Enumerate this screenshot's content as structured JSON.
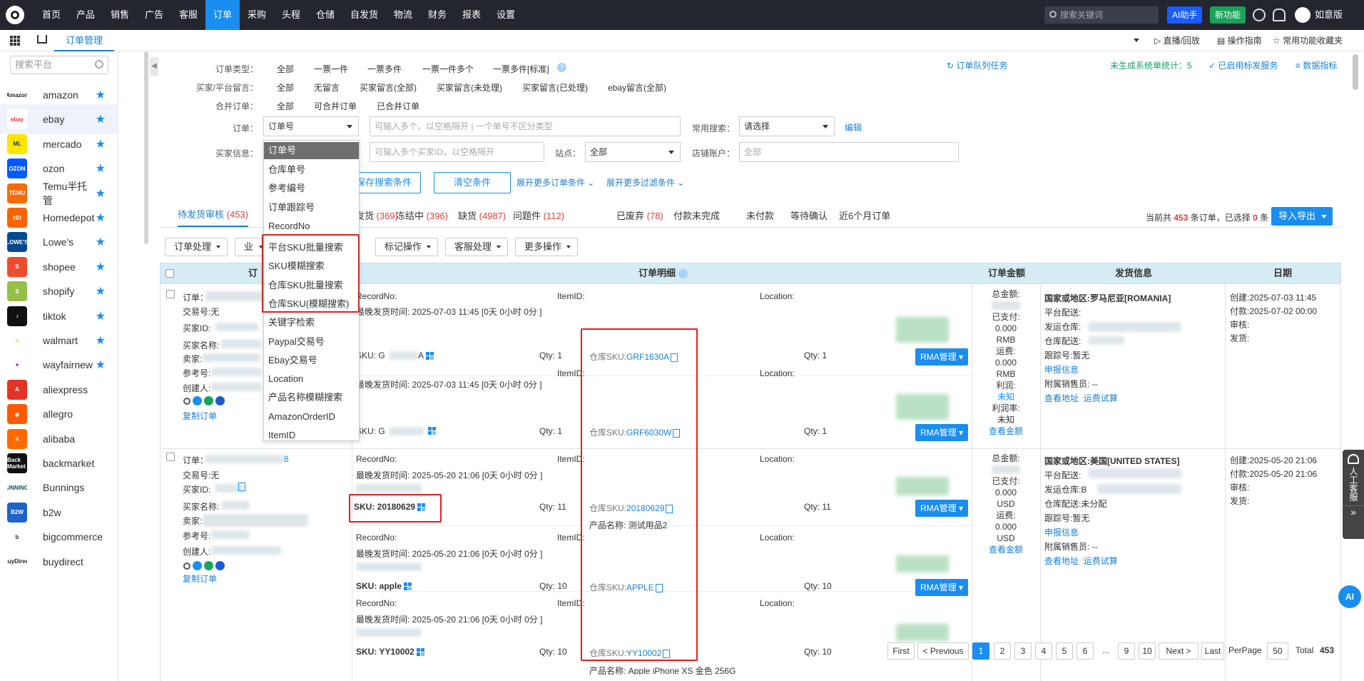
{
  "topnav": {
    "items": [
      "首页",
      "产品",
      "销售",
      "广告",
      "客服",
      "订单",
      "采购",
      "头程",
      "仓储",
      "自发货",
      "物流",
      "财务",
      "报表",
      "设置"
    ],
    "active_index": 5,
    "search_placeholder": "搜索关键词",
    "ai_button": "AI助手",
    "new_feature_button": "新功能",
    "user_name": "如意版"
  },
  "bar2": {
    "tab": "订单管理",
    "live_link": "直播/回放",
    "guide_link": "操作指南",
    "favorites_link": "常用功能收藏夹"
  },
  "sidebar": {
    "search_placeholder": "搜索平台",
    "platforms": [
      {
        "name": "amazon",
        "logo": "Amazon",
        "color": "#ffffff",
        "text_color": "#222222"
      },
      {
        "name": "ebay",
        "logo": "ebay",
        "color": "#ffffff",
        "text_color": "#e53238"
      },
      {
        "name": "mercado",
        "logo": "ML",
        "color": "#ffe600",
        "text_color": "#2d3277"
      },
      {
        "name": "ozon",
        "logo": "OZON",
        "color": "#005bff",
        "text_color": "#ffffff"
      },
      {
        "name": "Temu半托管",
        "logo": "TEMU",
        "color": "#f56b0a",
        "text_color": "#ffffff"
      },
      {
        "name": "Homedepot",
        "logo": "HD",
        "color": "#f96302",
        "text_color": "#ffffff"
      },
      {
        "name": "Lowe's",
        "logo": "LOWE'S",
        "color": "#004990",
        "text_color": "#ffffff"
      },
      {
        "name": "shopee",
        "logo": "S",
        "color": "#ee4d2d",
        "text_color": "#ffffff"
      },
      {
        "name": "shopify",
        "logo": "S",
        "color": "#95bf47",
        "text_color": "#ffffff"
      },
      {
        "name": "tiktok",
        "logo": "♪",
        "color": "#111111",
        "text_color": "#ffffff"
      },
      {
        "name": "walmart",
        "logo": "✳",
        "color": "#ffffff",
        "text_color": "#ffc220"
      },
      {
        "name": "wayfairnew",
        "logo": "✦",
        "color": "#ffffff",
        "text_color": "#7b189f"
      },
      {
        "name": "aliexpress",
        "logo": "A",
        "color": "#e43225",
        "text_color": "#ffffff"
      },
      {
        "name": "allegro",
        "logo": "◉",
        "color": "#ff5a00",
        "text_color": "#ffffff"
      },
      {
        "name": "alibaba",
        "logo": "a",
        "color": "#ff6a00",
        "text_color": "#ffffff"
      },
      {
        "name": "backmarket",
        "logo": "Back Market",
        "color": "#111111",
        "text_color": "#ffffff"
      },
      {
        "name": "Bunnings",
        "logo": "BUNNINGS",
        "color": "#ffffff",
        "text_color": "#0d5257"
      },
      {
        "name": "b2w",
        "logo": "B2W",
        "color": "#1e63c6",
        "text_color": "#ffffff"
      },
      {
        "name": "bigcommerce",
        "logo": "b",
        "color": "#ffffff",
        "text_color": "#34313f"
      },
      {
        "name": "buydirect",
        "logo": "BuyDirect",
        "color": "#ffffff",
        "text_color": "#222222"
      }
    ],
    "starred_count": 12,
    "selected_index": 1
  },
  "filters": {
    "order_type_label": "订单类型：",
    "order_types": [
      "全部",
      "一票一件",
      "一票多件",
      "一票一件多个",
      "一票多件[标准]"
    ],
    "message_label": "买家/平台留言：",
    "messages": [
      "全部",
      "无留言",
      "买家留言(全部)",
      "买家留言(未处理)",
      "买家留言(已处理)",
      "ebay留言(全部)"
    ],
    "merge_label": "合并订单：",
    "merges": [
      "全部",
      "可合并订单",
      "已合并订单"
    ],
    "order_label": "订单：",
    "order_select": "订单号",
    "order_input_placeholder": "可输入多个，以空格隔开 | 一个单号不区分类型",
    "common_search_label": "常用搜索：",
    "common_search_select": "请选择",
    "edit_link": "编辑",
    "buyer_label": "买家信息：",
    "buyer_input_placeholder": "可输入多个买家ID，以空格隔开",
    "site_label": "站点：",
    "site_select": "全部",
    "store_label": "店铺账户：",
    "store_input_placeholder": "全部",
    "save_button": "保存搜索条件",
    "clear_button": "清空条件",
    "expand_order": "展开更多订单条件",
    "expand_filter": "展开更多过滤条件",
    "queue_task": "订单队列任务",
    "ungenerated_stat": "未生成系统单统计：5",
    "enabled_service": "已启用标发服务",
    "data_metrics": "数据指标"
  },
  "dropdown": {
    "items": [
      "订单号",
      "仓库单号",
      "参考编号",
      "订单跟踪号",
      "RecordNo",
      "平台SKU批量搜索",
      "SKU模糊搜索",
      "仓库SKU批量搜索",
      "仓库SKU(模糊搜索)",
      "关键字检索",
      "Paypal交易号",
      "Ebay交易号",
      "Location",
      "产品名称模糊搜索",
      "AmazonOrderID",
      "ItemID"
    ],
    "highlighted_index": 0
  },
  "status_tabs": {
    "pending_review": "待发货审核",
    "pending_count": "(453)",
    "tabs": [
      {
        "label": "发货",
        "count": "(369)"
      },
      {
        "label": "冻结中",
        "count": "(396)"
      },
      {
        "label": "缺货",
        "count": "(4987)"
      },
      {
        "label": "问题件",
        "count": "(112)"
      },
      {
        "label": "已废弃",
        "count": "(78)"
      },
      {
        "label": "付款未完成",
        "count": ""
      },
      {
        "label": "未付款",
        "count": ""
      },
      {
        "label": "等待确认",
        "count": ""
      },
      {
        "label": "近6个月订单",
        "count": ""
      }
    ],
    "summary_prefix": "当前共",
    "summary_total": "453",
    "summary_mid": "条订单，已选择",
    "summary_selected": "0",
    "summary_suffix": "条",
    "import_export": "导入导出"
  },
  "actions": [
    "订单处理",
    "业务",
    "标记操作",
    "客服处理",
    "更多操作"
  ],
  "table": {
    "headers": {
      "order": "订",
      "detail": "订单明细",
      "amount": "订单金额",
      "shipping": "发货信息",
      "date": "日期"
    },
    "orders": [
      {
        "order_no": "订单：",
        "order_no_tail": "",
        "trade_no": "交易号:无",
        "buyer_id": "买家ID:",
        "buyer_name": "买家名称:",
        "seller": "卖家:",
        "ref": "参考号:",
        "creator": "创建人:",
        "copy": "复制订单",
        "items": [
          {
            "record": "RecordNo:",
            "deadline": "最晚发货时间: 2025-07-03 11:45 [0天 0小时 0分 ]",
            "sku": "SKU: G",
            "sku_tail": "A",
            "qty": "Qty: 1",
            "itemid": "ItemID:",
            "wsku_label": "仓库SKU:",
            "wsku": "GRF1630A",
            "qty2": "Qty: 1",
            "location": "Location:",
            "rma": "RMA管理"
          },
          {
            "record": "",
            "deadline": "最晚发货时间: 2025-07-03 11:45 [0天 0小时 0分 ]",
            "sku": "SKU: G",
            "sku_tail": "",
            "qty": "Qty: 1",
            "itemid": "ItemID:",
            "wsku_label": "仓库SKU:",
            "wsku": "GRF6030W",
            "qty2": "Qty: 1",
            "location": "Location:",
            "rma": "RMA管理"
          }
        ],
        "amount": {
          "total": "总金额:",
          "paid": "已支付:",
          "paid_v": "0.000",
          "paid_c": "RMB",
          "ship": "运费:",
          "ship_v": "0.000",
          "ship_c": "RMB",
          "profit": "利润:",
          "profit_v": "未知",
          "rate": "利润率:",
          "rate_v": "未知",
          "view": "查看金额"
        },
        "shipping": {
          "country": "国家或地区:罗马尼亚[ROMANIA]",
          "platform": "平台配送:",
          "warehouse": "发运仓库:",
          "wh_dist": "仓库配送:",
          "tracking": "跟踪号:暂无",
          "report": "申报信息",
          "sales": "附属销售员: --",
          "addr": "查看地址",
          "freight": "运费试算"
        },
        "dates": {
          "created": "创建:2025-07-03 11:45",
          "paid": "付款:2025-07-02 00:00",
          "review": "审核:",
          "ship": "发货:"
        }
      },
      {
        "order_no": "订单：",
        "order_no_tail": "8",
        "trade_no": "交易号:无",
        "buyer_id": "买家ID:",
        "buyer_name": "买家名称:",
        "seller": "卖家:",
        "ref": "参考号:",
        "creator": "创建人:",
        "copy": "复制订单",
        "items": [
          {
            "record": "RecordNo:",
            "deadline": "最晚发货时间: 2025-05-20 21:06 [0天 0小时 0分 ]",
            "sku": "SKU: 20180629",
            "qty": "Qty: 11",
            "itemid": "ItemID:",
            "wsku_label": "仓库SKU:",
            "wsku": "20180629",
            "qty2": "Qty: 11",
            "product": "产品名称: 测试用品2",
            "location": "Location:",
            "rma": "RMA管理"
          },
          {
            "record": "RecordNo:",
            "deadline": "最晚发货时间: 2025-05-20 21:06 [0天 0小时 0分 ]",
            "sku": "SKU: apple",
            "qty": "Qty: 10",
            "itemid": "ItemID:",
            "wsku_label": "仓库SKU:",
            "wsku": "APPLE",
            "qty2": "Qty: 10",
            "location": "Location:",
            "rma": "RMA管理"
          },
          {
            "record": "RecordNo:",
            "deadline": "最晚发货时间: 2025-05-20 21:06 [0天 0小时 0分 ]",
            "sku": "SKU: YY10002",
            "qty": "Qty: 10",
            "itemid": "ItemID:",
            "wsku_label": "仓库SKU:",
            "wsku": "YY10002",
            "qty2": "Qty: 10",
            "location": "Location:",
            "rma": ""
          }
        ],
        "amount": {
          "total": "总金额:",
          "paid": "已支付:",
          "paid_v": "0.000",
          "paid_c": "USD",
          "ship": "运费:",
          "ship_v": "0.000",
          "ship_c": "USD",
          "view": "查看金额"
        },
        "shipping": {
          "country": "国家或地区:美国[UNITED STATES]",
          "platform": "平台配送:",
          "warehouse": "发运仓库:B",
          "wh_dist": "仓库配送:未分配",
          "tracking": "跟踪号:暂无",
          "report": "申报信息",
          "sales": "附属销售员: --",
          "addr": "查看地址",
          "freight": "运费试算"
        },
        "dates": {
          "created": "创建:2025-05-20 21:06",
          "paid": "付款:2025-05-20 21:06",
          "review": "审核:",
          "ship": "发货:"
        }
      }
    ],
    "cut_off_text": "产品名称: Apple iPhone XS 金色 256G"
  },
  "pagination": {
    "first": "First",
    "prev": "< Previous",
    "pages": [
      "1",
      "2",
      "3",
      "4",
      "5",
      "6",
      "...",
      "9",
      "10"
    ],
    "current": "1",
    "next": "Next >",
    "last": "Last",
    "per_page_label": "PerPage",
    "per_page": "50",
    "total_label": "Total",
    "total": "453"
  },
  "floats": {
    "customer_service": "人工客服",
    "ai": "AI",
    "expand": "»"
  },
  "colors": {
    "accent": "#1a8ef0",
    "nav_bg": "#23262e",
    "highlight_box": "#e02020",
    "count_red": "#e23c3c"
  }
}
